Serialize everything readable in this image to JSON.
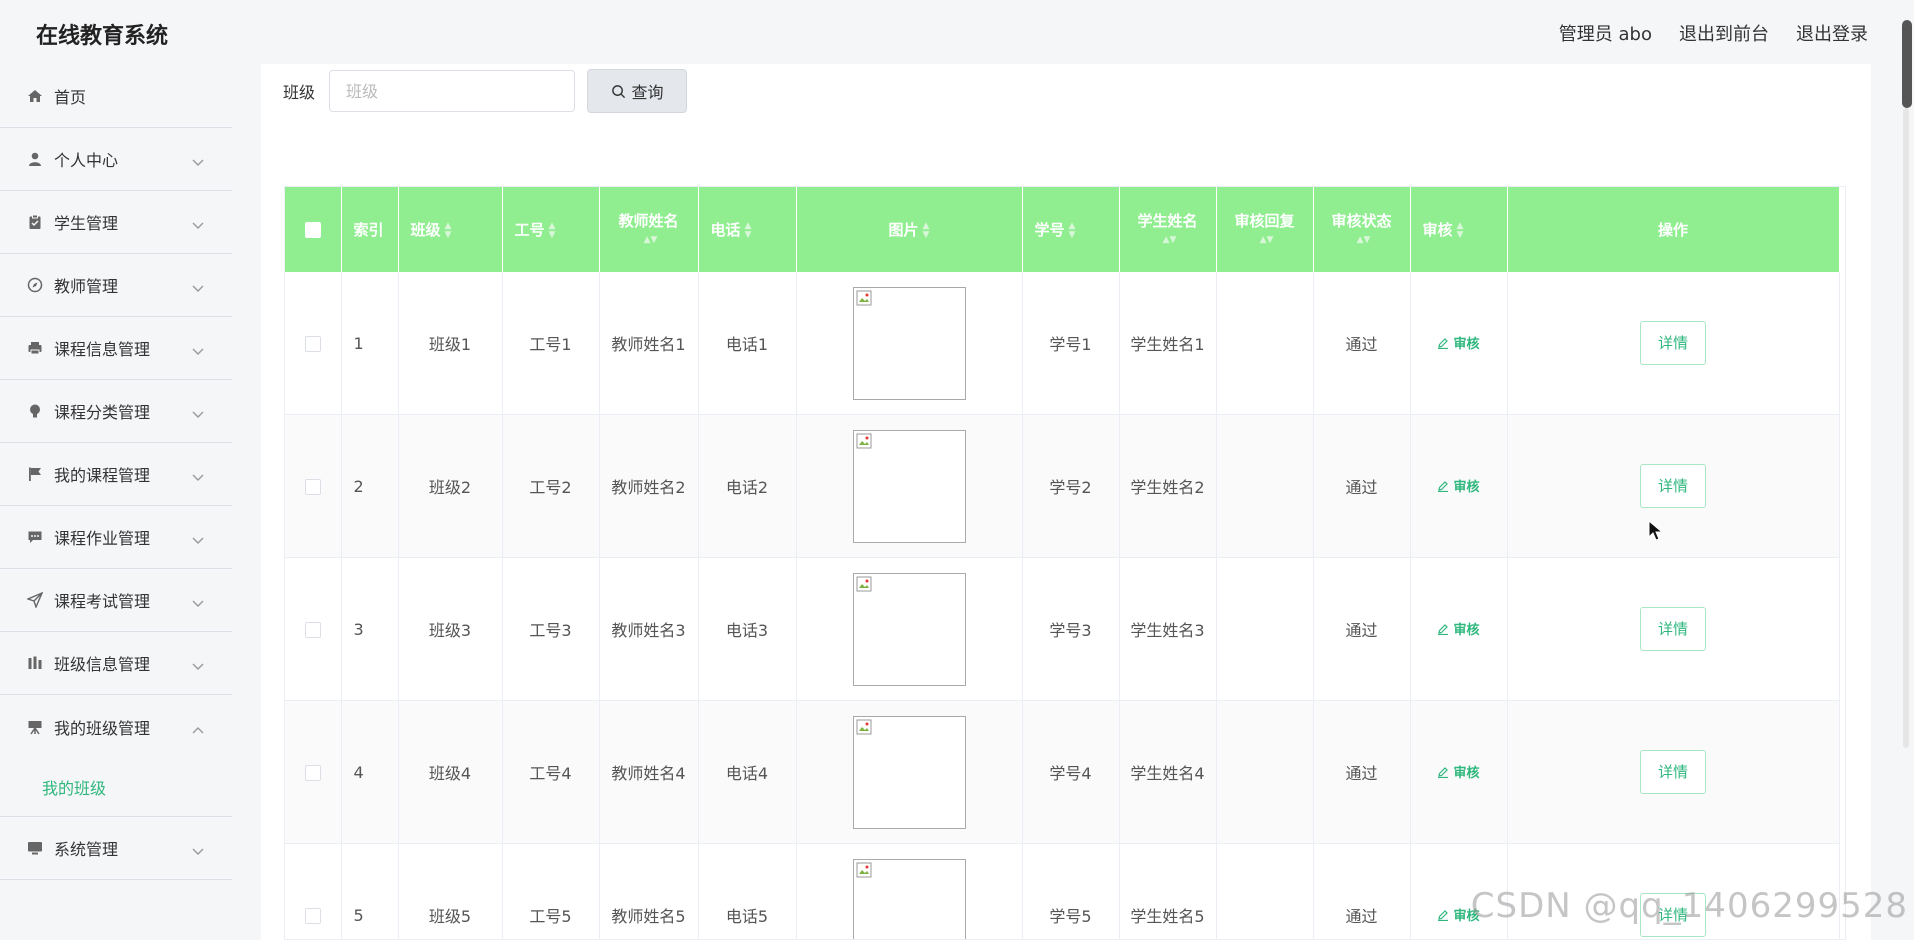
{
  "header": {
    "title": "在线教育系统",
    "user": "管理员 abo",
    "to_front": "退出到前台",
    "logout": "退出登录"
  },
  "sidebar": {
    "items": [
      {
        "label": "首页",
        "icon": "home-icon"
      },
      {
        "label": "个人中心",
        "icon": "user-icon"
      },
      {
        "label": "学生管理",
        "icon": "clipboard-icon"
      },
      {
        "label": "教师管理",
        "icon": "compass-icon"
      },
      {
        "label": "课程信息管理",
        "icon": "printer-icon"
      },
      {
        "label": "课程分类管理",
        "icon": "bulb-icon"
      },
      {
        "label": "我的课程管理",
        "icon": "flag-icon"
      },
      {
        "label": "课程作业管理",
        "icon": "chat-icon"
      },
      {
        "label": "课程考试管理",
        "icon": "send-icon"
      },
      {
        "label": "班级信息管理",
        "icon": "building-icon"
      },
      {
        "label": "我的班级管理",
        "icon": "easel-icon",
        "expanded": true
      },
      {
        "label": "系统管理",
        "icon": "monitor-icon"
      }
    ],
    "submenu_active": "我的班级"
  },
  "search": {
    "label": "班级",
    "placeholder": "班级",
    "button": "查询"
  },
  "table": {
    "columns": [
      "索引",
      "班级",
      "工号",
      "教师姓名",
      "电话",
      "图片",
      "学号",
      "学生姓名",
      "审核回复",
      "审核状态",
      "审核",
      "操作"
    ],
    "review_label": "审核",
    "detail_label": "详情",
    "rows": [
      {
        "index": "1",
        "class": "班级1",
        "job_no": "工号1",
        "teacher": "教师姓名1",
        "phone": "电话1",
        "student_no": "学号1",
        "student": "学生姓名1",
        "reply": "",
        "status": "通过"
      },
      {
        "index": "2",
        "class": "班级2",
        "job_no": "工号2",
        "teacher": "教师姓名2",
        "phone": "电话2",
        "student_no": "学号2",
        "student": "学生姓名2",
        "reply": "",
        "status": "通过"
      },
      {
        "index": "3",
        "class": "班级3",
        "job_no": "工号3",
        "teacher": "教师姓名3",
        "phone": "电话3",
        "student_no": "学号3",
        "student": "学生姓名3",
        "reply": "",
        "status": "通过"
      },
      {
        "index": "4",
        "class": "班级4",
        "job_no": "工号4",
        "teacher": "教师姓名4",
        "phone": "电话4",
        "student_no": "学号4",
        "student": "学生姓名4",
        "reply": "",
        "status": "通过"
      },
      {
        "index": "5",
        "class": "班级5",
        "job_no": "工号5",
        "teacher": "教师姓名5",
        "phone": "电话5",
        "student_no": "学号5",
        "student": "学生姓名5",
        "reply": "",
        "status": "通过"
      }
    ]
  },
  "watermark": "CSDN @qq_1406299528",
  "colors": {
    "table_header": "#90ee90",
    "accent": "#2fb77d"
  }
}
